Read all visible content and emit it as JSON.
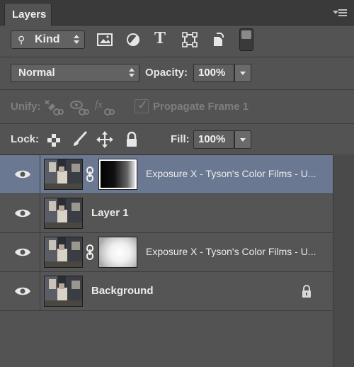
{
  "panel": {
    "tab_label": "Layers"
  },
  "filter": {
    "kind_label": "Kind",
    "icons": [
      "pixel-layer-filter-icon",
      "adjustment-layer-filter-icon",
      "type-layer-filter-icon",
      "shape-layer-filter-icon",
      "smart-object-filter-icon"
    ],
    "type_glyph": "T"
  },
  "blend": {
    "mode": "Normal",
    "opacity_label": "Opacity:",
    "opacity_value": "100%"
  },
  "unify": {
    "label": "Unify:",
    "propagate_label": "Propagate Frame 1",
    "propagate_checked": true
  },
  "lock": {
    "label": "Lock:",
    "fill_label": "Fill:",
    "fill_value": "100%"
  },
  "layers": [
    {
      "name": "Exposure X - Tyson's Color Films - U...",
      "has_mask": true,
      "mask": "gradient",
      "selected": true,
      "visible": true,
      "locked": false
    },
    {
      "name": "Layer 1",
      "has_mask": false,
      "selected": false,
      "visible": true,
      "locked": false
    },
    {
      "name": "Exposure X - Tyson's Color Films - U...",
      "has_mask": true,
      "mask": "glow",
      "selected": false,
      "visible": true,
      "locked": false
    },
    {
      "name": "Background",
      "has_mask": false,
      "selected": false,
      "visible": true,
      "locked": true
    }
  ],
  "colors": {
    "panel_bg": "#535353",
    "selected_row": "#6b7891",
    "tab_bar": "#3a3a3a"
  }
}
